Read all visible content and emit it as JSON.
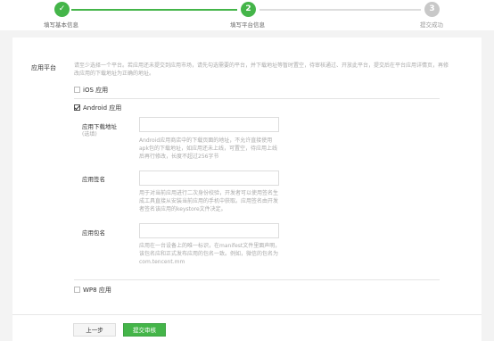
{
  "stepper": {
    "steps": [
      {
        "label": "填写基本信息",
        "symbol": "✓"
      },
      {
        "label": "填写平台信息",
        "symbol": "2"
      },
      {
        "label": "提交成功",
        "symbol": "3"
      }
    ]
  },
  "form": {
    "section_label": "应用平台",
    "hint": "请至少选择一个平台。若应用还未提交到应用市场，请先勾选需要的平台，并下载地址等暂时置空，待审核通过、开放此平台，提交后在平台应用详情页，再修改应用的下载地址为正确的地址。",
    "platforms": {
      "ios": {
        "label": "iOS 应用",
        "checked": false
      },
      "android": {
        "label": "Android 应用",
        "checked": true
      },
      "wp8": {
        "label": "WP8 应用",
        "checked": false
      }
    },
    "android_fields": {
      "download": {
        "label": "应用下载地址",
        "sublabel": "(选填)",
        "value": "",
        "desc": "Android应用商店中的下载页面的地址，不允许直接使用apk包的下载地址，如应用还未上线，可置空，待应用上线后再行修改，长度不超过256字节"
      },
      "signature": {
        "label": "应用签名",
        "value": "",
        "desc": "用于对当前应用进行二次身份校验，开发者可以使用签名生成工具直接从安装当前应用的手机中获取。应用签名由开发者签名该应用的keystore文件决定。"
      },
      "package": {
        "label": "应用包名",
        "value": "",
        "desc": "应用在一台设备上的唯一标识，在manifest文件里面声明，该包名应和正式发布应用的包名一致。例如，微信的包名为com.tencent.mm"
      }
    }
  },
  "buttons": {
    "prev": "上一步",
    "submit": "提交审核"
  },
  "colors": {
    "accent": "#44b549",
    "inactive_step": "#c8c8c8"
  }
}
